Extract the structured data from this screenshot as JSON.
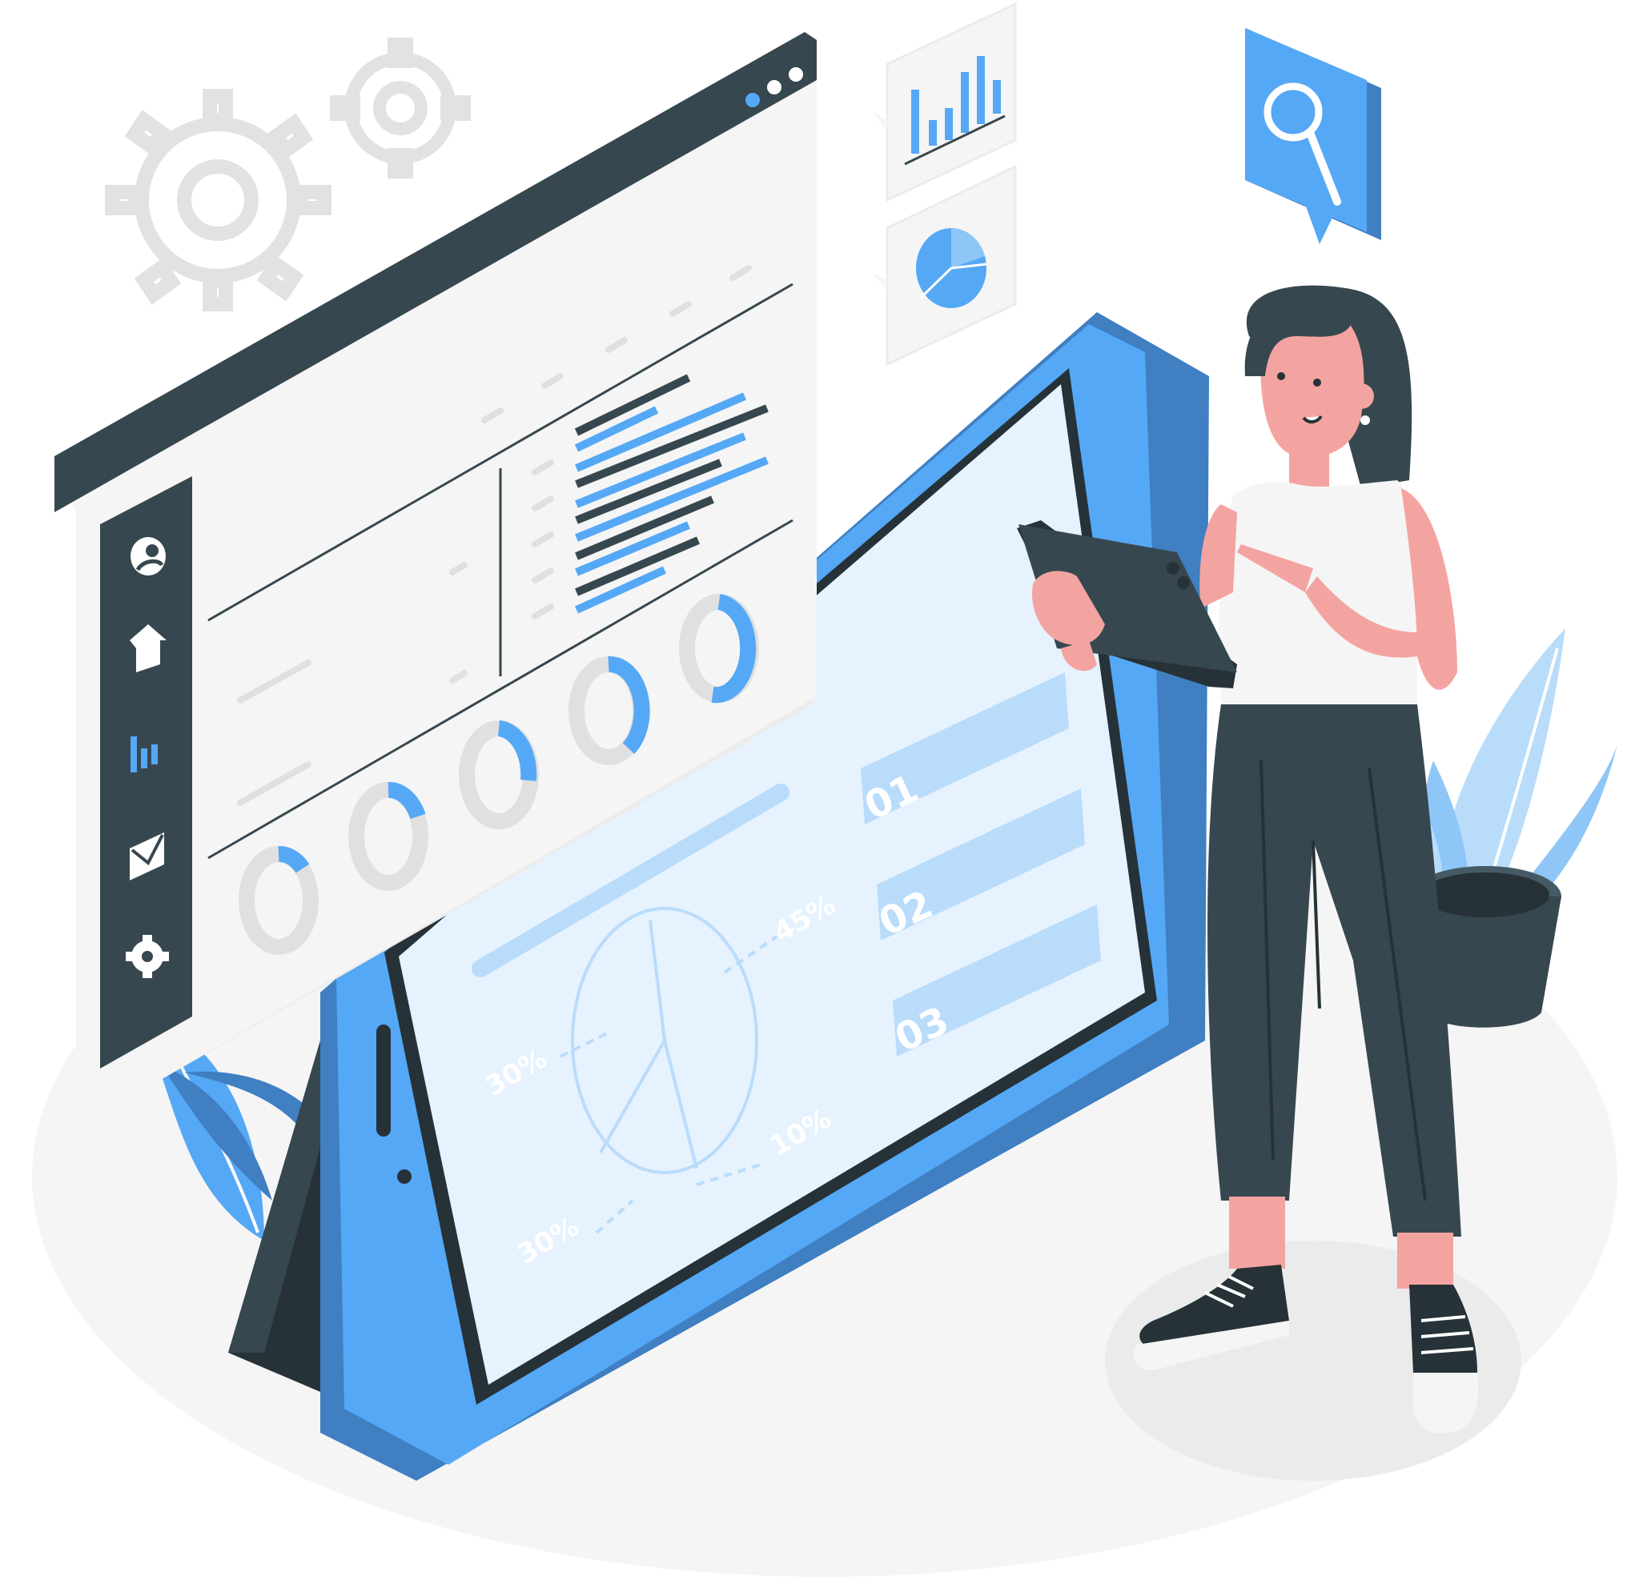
{
  "colors": {
    "blue": "#55a8f5",
    "blue_dark": "#3f7fc2",
    "light_blue": "#b9dcfb",
    "screen_bg": "#e6f2fd",
    "dark": "#37474f",
    "panel": "#f5f5f5",
    "grey_line": "#e0e0e0",
    "skin": "#f4a4a0"
  },
  "dashboard_window": {
    "sidebar_icons": [
      "user-icon",
      "home-icon",
      "bar-chart-icon",
      "mail-icon",
      "gear-icon"
    ],
    "window_controls": [
      "dot",
      "dot",
      "dot"
    ]
  },
  "tablet_screen": {
    "list_items": [
      "01",
      "02",
      "03"
    ],
    "pie_labels": [
      "45%",
      "30%",
      "10%",
      "30%"
    ]
  },
  "floating_cards": [
    "bar-chart-card",
    "pie-chart-card",
    "search-bubble"
  ]
}
